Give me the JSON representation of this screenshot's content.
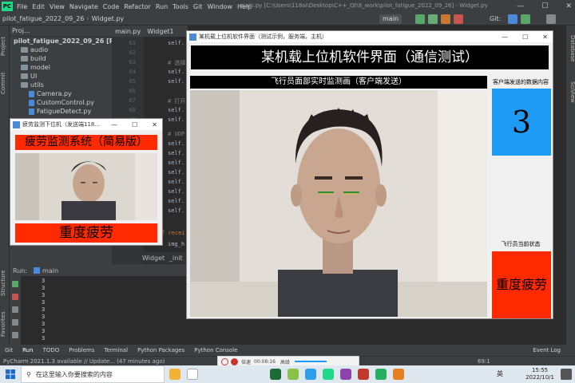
{
  "ide": {
    "title_path": "main.py [C:\\Users\\118ai\\Desktop\\C++_Qt\\8_work\\pilot_fatigue_2022_09_26] - Widget.py",
    "menu": [
      "File",
      "Edit",
      "View",
      "Navigate",
      "Code",
      "Refactor",
      "Run",
      "Tools",
      "Git",
      "Window",
      "Help"
    ],
    "breadcrumb": {
      "project": "pilot_fatigue_2022_09_26",
      "file": "Widget.py"
    },
    "branch": "main",
    "git_label": "Git:",
    "project_panel": {
      "header": "Proj...",
      "root": "pilot_fatigue_2022_09_26 [Py",
      "items": [
        "audio",
        "build",
        "model",
        "UI",
        "utils",
        "Camera.py",
        "CustomControl.py",
        "FatigueDetect.py"
      ]
    },
    "editor_tabs": [
      "main.py",
      "Widget1"
    ],
    "line_numbers": [
      "61",
      "62",
      "63",
      "64",
      "65",
      "66",
      "67",
      "68",
      "69",
      "70",
      "71",
      "72",
      "73",
      "74",
      "75",
      "76",
      "77",
      "78",
      "79",
      "80",
      "81"
    ],
    "code_lines": [
      "self.",
      "# 选择",
      "self.",
      "self.",
      "# 打开",
      "self.",
      "self.",
      "# UDP",
      "self.",
      "self.",
      "self.",
      "self.",
      "self.",
      "self.",
      "self.",
      "self.",
      "f recei",
      "img_h"
    ],
    "code_footer": [
      "Widget",
      "_init"
    ],
    "run": {
      "label": "Run:",
      "config": "main",
      "output": [
        "3",
        "3",
        "3",
        "3",
        "3",
        "3",
        "3",
        "3",
        "3",
        "3"
      ]
    },
    "left_tabs": [
      "Project",
      "Commit",
      "Structure",
      "Favorites"
    ],
    "right_tabs": [
      "Database",
      "SciView"
    ],
    "bottom_tabs": [
      "Git",
      "Run",
      "TODO",
      "Problems",
      "Terminal",
      "Python Packages",
      "Python Console",
      "Event Log"
    ],
    "status": "PyCharm 2021.1.3 available // Update... (47 minutes ago)",
    "caret": "69:1"
  },
  "fatigue_window": {
    "title": "疲劳监测下位机（发送端118...",
    "banner": "疲劳监测系统（简易版）",
    "state": "重度疲劳"
  },
  "main_window": {
    "title": "某机载上位机软件界面（测试示例，服务端，主机）",
    "header": "某机载上位机软件界面（通信测试）",
    "feed_label": "飞行员面部实时监测画（客户端发送）",
    "recv_label": "客户端发送的数据内容",
    "recv_value": "3",
    "state_label": "飞行员当前状态",
    "state_value": "重度疲劳"
  },
  "media": {
    "speed": "倍速",
    "time": "00:08:16",
    "extra": "高级"
  },
  "taskbar": {
    "search_placeholder": "在这里输入你要搜索的内容",
    "time": "15:55",
    "date": "2022/10/1",
    "lang": "英"
  },
  "colors": {
    "alarm": "#ff2a00",
    "info": "#1e9bf5",
    "ide_bg": "#2b2b2b",
    "ide_panel": "#3c3f41"
  }
}
